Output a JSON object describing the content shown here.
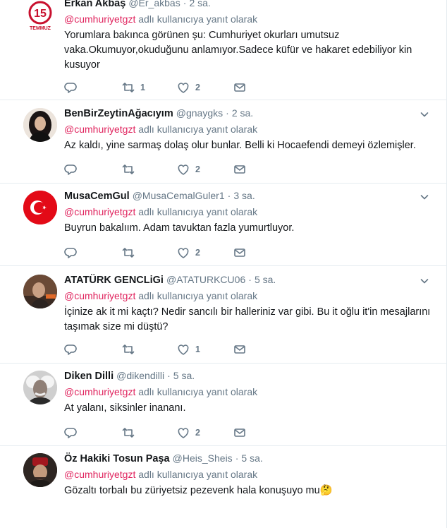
{
  "reply_prefix": "adlı kullanıcıya yanıt olarak",
  "tweets": [
    {
      "name": "Erkan Akbaş",
      "handle": "@Er_akbas",
      "time": "2 sa.",
      "reply_to": "@cumhuriyetgzt",
      "text": "Yorumlara bakınca görünen şu: Cumhuriyet okurları umutsuz vaka.Okumuyor,okuduğunu anlamıyor.Sadece küfür ve hakaret  edebiliyor kin kusuyor",
      "retweets": "1",
      "likes": "2",
      "avatar_text": "15",
      "avatar_sub": "TEMMUZ"
    },
    {
      "name": "BenBirZeytinAğacıyım",
      "handle": "@gnaygks",
      "time": "2 sa.",
      "reply_to": "@cumhuriyetgzt",
      "text": "Az kaldı, yine sarmaş dolaş olur bunlar. Belli ki Hocaefendi demeyi özlemişler.",
      "retweets": "",
      "likes": "2"
    },
    {
      "name": "MusaCemGul",
      "handle": "@MusaCemalGuler1",
      "time": "3 sa.",
      "reply_to": "@cumhuriyetgzt",
      "text": "Buyrun bakalıım. Adam tavuktan fazla yumurtluyor.",
      "retweets": "",
      "likes": "2"
    },
    {
      "name": "ATATÜRK GENCLiGi",
      "handle": "@ATATURKCU06",
      "time": "5 sa.",
      "reply_to": "@cumhuriyetgzt",
      "text": "İçinize ak it mi kaçtı? Nedir sancılı bir halleriniz var gibi. Bu it oğlu it'in mesajlarını taşımak size mi düştü?",
      "retweets": "",
      "likes": "1"
    },
    {
      "name": "Diken Dilli",
      "handle": "@dikendilli",
      "time": "5 sa.",
      "reply_to": "@cumhuriyetgzt",
      "text": "At yalanı, siksinler inananı.",
      "retweets": "",
      "likes": "2"
    },
    {
      "name": "Öz Hakiki Tosun Paşa",
      "handle": "@Heis_Sheis",
      "time": "5 sa.",
      "reply_to": "@cumhuriyetgzt",
      "text": "Gözaltı torbalı bu züriyetsiz pezevenk hala konuşuyo mu",
      "emoji": "🤔"
    }
  ],
  "colors": {
    "mention": "#e0245e",
    "muted": "#657786",
    "text": "#14171a",
    "border": "#e6ecf0"
  },
  "icons": [
    "reply-icon",
    "retweet-icon",
    "like-icon",
    "message-icon",
    "chevron-down-icon"
  ]
}
